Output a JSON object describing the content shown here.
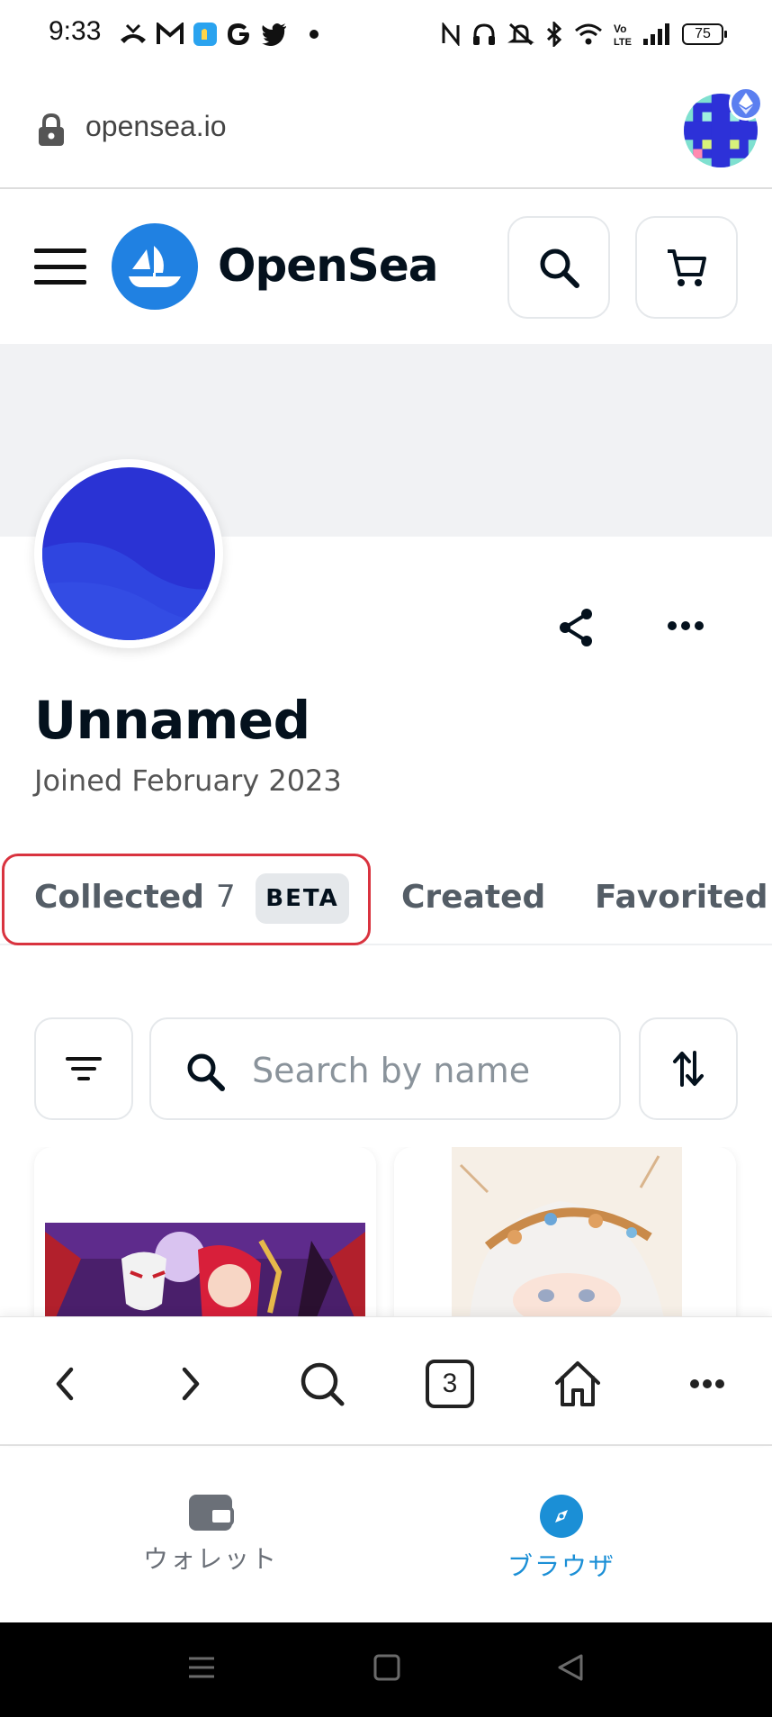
{
  "status_bar": {
    "time": "9:33",
    "left_icons": [
      "missed-call-icon",
      "gmail-icon",
      "app-icon",
      "google-icon",
      "twitter-icon"
    ],
    "right_icons": [
      "nfc-icon",
      "headset-icon",
      "mute-icon",
      "bluetooth-icon",
      "wifi-icon",
      "volte-icon",
      "signal-icon"
    ],
    "battery": "75"
  },
  "url_bar": {
    "url": "opensea.io"
  },
  "header": {
    "brand": "OpenSea",
    "brand_color": "#2081e2"
  },
  "profile": {
    "name": "Unnamed",
    "joined": "Joined February 2023",
    "avatar_color": "#2938d6"
  },
  "tabs": {
    "collected": "Collected",
    "collected_count": "7",
    "beta": "BETA",
    "created": "Created",
    "favorited": "Favorited"
  },
  "filters": {
    "search_placeholder": "Search by name"
  },
  "browser_bar": {
    "tab_count": "3"
  },
  "app_nav": {
    "wallet_label": "ウォレット",
    "browser_label": "ブラウザ",
    "active_color": "#1b8fd6",
    "inactive_color": "#6b7078"
  },
  "highlight_color": "#d9333f"
}
